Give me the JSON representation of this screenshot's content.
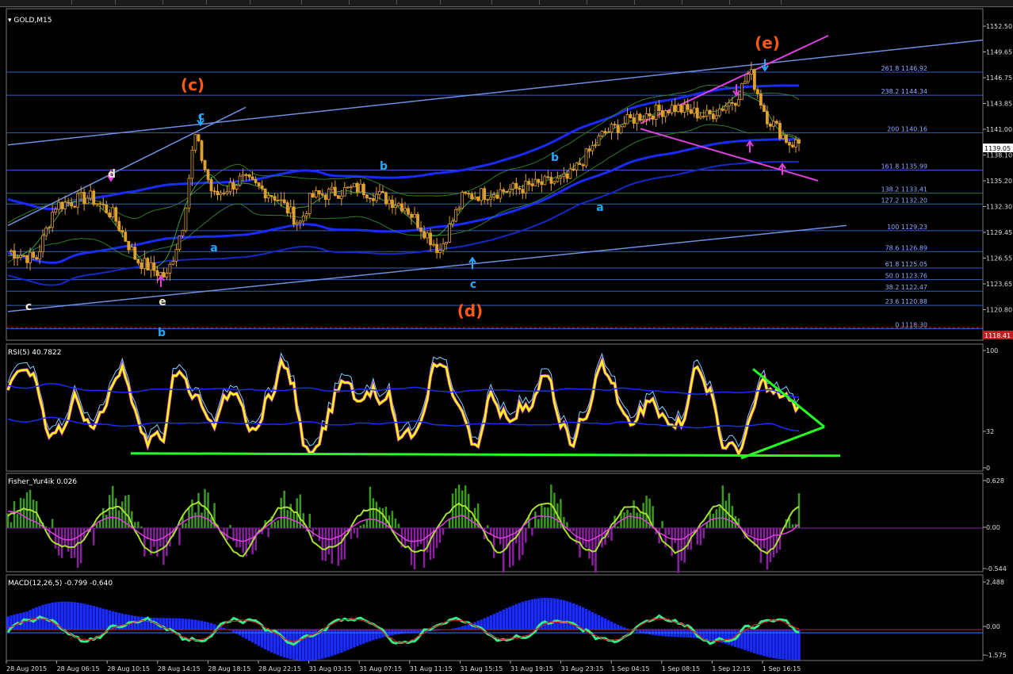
{
  "window": {
    "symbol_label": "GOLD,M15"
  },
  "panels": {
    "rsi": "RSI(5) 40.7822",
    "fisher": "Fisher_Yur4ik 0.026",
    "macd": "MACD(12,26,5) -0.799 -0.640"
  },
  "colors": {
    "bg": "#000000",
    "grid": "#1f2a44",
    "candle": "#e0a030",
    "fibo": "#3b5bbf",
    "wave_orange": "#ff5a14",
    "wave_blue": "#27a8ff",
    "wave_white": "#f0e8d0",
    "magenta": "#e040e0",
    "yellow": "#ffff00",
    "green": "#22ff22",
    "fisher_green": "#3a9a20",
    "fisher_purple": "#8a20a0",
    "macd_blue": "#1a2bff"
  },
  "chart_data": [
    {
      "type": "candlestick",
      "title": "GOLD,M15",
      "price_axis": [
        "1152.50",
        "1149.65",
        "1146.75",
        "1143.85",
        "1141.00",
        "1138.10",
        "1135.20",
        "1132.30",
        "1129.45",
        "1126.55",
        "1123.65",
        "1120.80"
      ],
      "current_price": "1139.05",
      "bid_price": "1118.41",
      "time_axis": [
        "28 Aug 2015",
        "28 Aug 06:15",
        "28 Aug 10:15",
        "28 Aug 14:15",
        "28 Aug 18:15",
        "28 Aug 22:15",
        "31 Aug 03:15",
        "31 Aug 07:15",
        "31 Aug 11:15",
        "31 Aug 15:15",
        "31 Aug 19:15",
        "31 Aug 23:15",
        "1 Sep 04:15",
        "1 Sep 08:15",
        "1 Sep 12:15",
        "1 Sep 16:15"
      ],
      "fibonacci_levels": [
        {
          "label": "261.8  1146.92",
          "price": 1146.92
        },
        {
          "label": "238.2  1144.34",
          "price": 1144.34
        },
        {
          "label": "200  1140.16",
          "price": 1140.16
        },
        {
          "label": "161.8  1135.99",
          "price": 1135.99
        },
        {
          "label": "138.2  1133.41",
          "price": 1133.41
        },
        {
          "label": "127.2  1132.20",
          "price": 1132.2
        },
        {
          "label": "100  1129.23",
          "price": 1129.23
        },
        {
          "label": "78.6  1126.89",
          "price": 1126.89
        },
        {
          "label": "61.8  1125.05",
          "price": 1125.05
        },
        {
          "label": "50.0  1123.76",
          "price": 1123.76
        },
        {
          "label": "38.2  1122.47",
          "price": 1122.47
        },
        {
          "label": "23.6  1120.88",
          "price": 1120.88
        },
        {
          "label": "0  1118.30",
          "price": 1118.3
        }
      ],
      "wave_labels": [
        {
          "text": "(c)",
          "color": "orange"
        },
        {
          "text": "(d)",
          "color": "orange"
        },
        {
          "text": "(e)",
          "color": "orange"
        },
        {
          "text": "c",
          "color": "blue"
        },
        {
          "text": "c",
          "color": "blue"
        },
        {
          "text": "b",
          "color": "blue"
        },
        {
          "text": "a",
          "color": "blue"
        },
        {
          "text": "b",
          "color": "blue"
        },
        {
          "text": "a",
          "color": "blue"
        },
        {
          "text": "b",
          "color": "blue"
        },
        {
          "text": "d",
          "color": "white"
        },
        {
          "text": "c",
          "color": "white"
        },
        {
          "text": "e",
          "color": "white"
        }
      ]
    },
    {
      "type": "line",
      "title": "RSI(5) 40.7822",
      "y_axis": [
        "100",
        "32",
        "0"
      ],
      "ylim": [
        0,
        100
      ]
    },
    {
      "type": "histogram",
      "title": "Fisher_Yur4ik 0.026",
      "y_axis": [
        "0.628",
        "0.00",
        "-0.544"
      ]
    },
    {
      "type": "histogram",
      "title": "MACD(12,26,5) -0.799 -0.640",
      "y_axis": [
        "2.488",
        "0.00",
        "-1.575"
      ]
    }
  ]
}
